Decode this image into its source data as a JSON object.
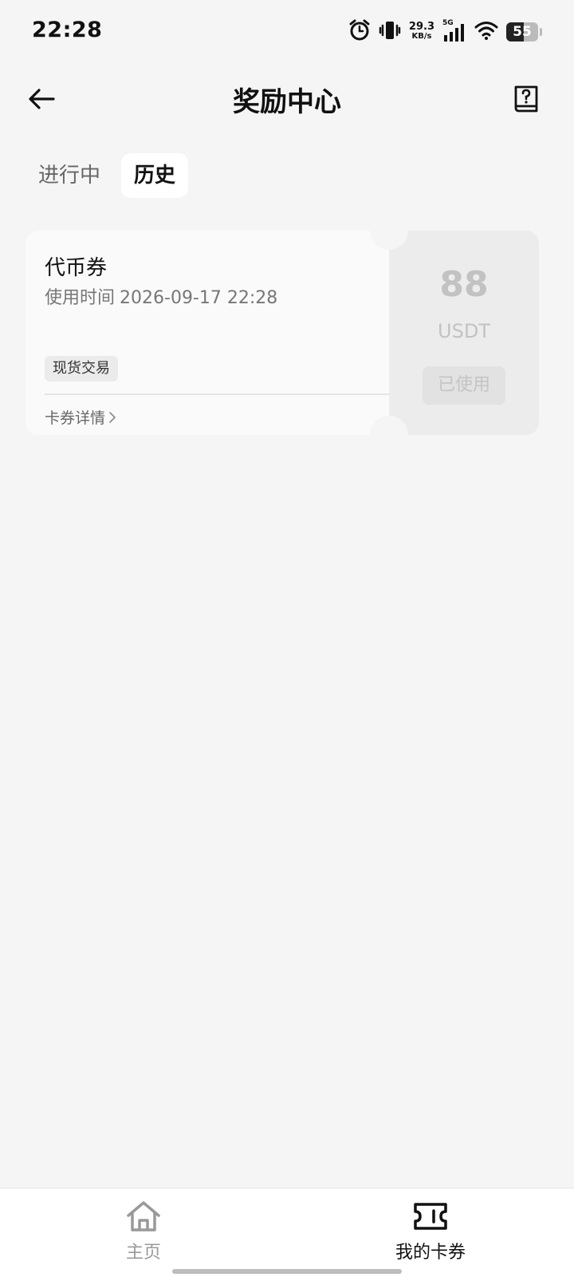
{
  "status_bar": {
    "time": "22:28",
    "net_speed_value": "29.3",
    "net_speed_unit": "KB/s",
    "network_type": "5G",
    "battery_level": "55",
    "battery_fraction": 0.55,
    "icons": [
      "alarm-icon",
      "vibrate-icon",
      "signal-icon",
      "wifi-icon",
      "battery-icon"
    ]
  },
  "header": {
    "title": "奖励中心",
    "back_icon": "arrow-left-icon",
    "help_icon": "help-book-icon"
  },
  "tabs": [
    {
      "label": "进行中",
      "active": false
    },
    {
      "label": "历史",
      "active": true
    }
  ],
  "coupons": [
    {
      "title": "代币券",
      "time_label": "使用时间",
      "time_value": "2026-09-17 22:28",
      "tag": "现货交易",
      "detail_label": "卡券详情",
      "amount": "88",
      "unit": "USDT",
      "status": "已使用"
    }
  ],
  "bottom_nav": {
    "items": [
      {
        "label": "主页",
        "icon": "home-icon",
        "active": false
      },
      {
        "label": "我的卡券",
        "icon": "ticket-icon",
        "active": true
      }
    ]
  },
  "colors": {
    "background": "#f5f5f5",
    "text_primary": "#111111",
    "text_muted": "#999999",
    "disabled": "#c2c2c2"
  }
}
